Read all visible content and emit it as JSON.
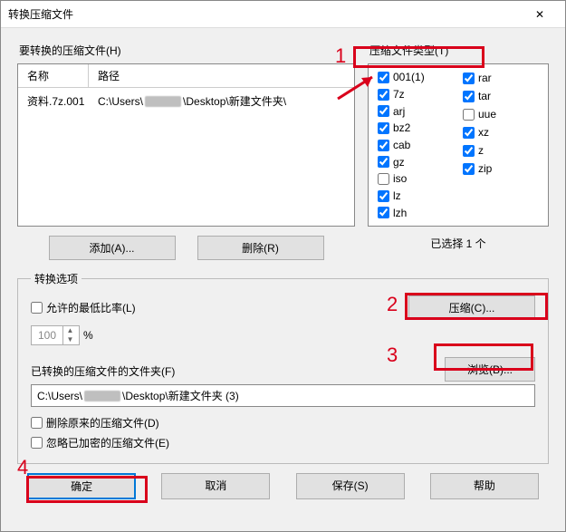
{
  "window": {
    "title": "转换压缩文件",
    "close": "✕"
  },
  "filesGroup": {
    "label": "要转换的压缩文件(H)",
    "colName": "名称",
    "colPath": "路径",
    "rows": [
      {
        "name": "资料.7z.001",
        "pathPrefix": "C:\\Users\\",
        "pathSuffix": "\\Desktop\\新建文件夹\\"
      }
    ],
    "addBtn": "添加(A)...",
    "removeBtn": "删除(R)"
  },
  "typesGroup": {
    "label": "压缩文件类型(T)",
    "left": [
      {
        "label": "001(1)",
        "checked": true
      },
      {
        "label": "7z",
        "checked": true
      },
      {
        "label": "arj",
        "checked": true
      },
      {
        "label": "bz2",
        "checked": true
      },
      {
        "label": "cab",
        "checked": true
      },
      {
        "label": "gz",
        "checked": true
      },
      {
        "label": "iso",
        "checked": false
      },
      {
        "label": "lz",
        "checked": true
      },
      {
        "label": "lzh",
        "checked": true
      }
    ],
    "right": [
      {
        "label": "rar",
        "checked": true
      },
      {
        "label": "tar",
        "checked": true
      },
      {
        "label": "uue",
        "checked": false
      },
      {
        "label": "xz",
        "checked": true
      },
      {
        "label": "z",
        "checked": true
      },
      {
        "label": "zip",
        "checked": true
      }
    ],
    "selectedText": "已选择 1 个"
  },
  "options": {
    "legend": "转换选项",
    "allowMin": "允许的最低比率(L)",
    "spinnerValue": "100",
    "percent": "%",
    "compressBtn": "压缩(C)...",
    "folderLabel": "已转换的压缩文件的文件夹(F)",
    "browseBtn": "浏览(B)...",
    "folderValuePrefix": "C:\\Users\\",
    "folderValueSuffix": "\\Desktop\\新建文件夹 (3)",
    "deleteOrig": "删除原来的压缩文件(D)",
    "ignoreEnc": "忽略已加密的压缩文件(E)"
  },
  "buttons": {
    "ok": "确定",
    "cancel": "取消",
    "save": "保存(S)",
    "help": "帮助"
  },
  "anno": {
    "n1": "1",
    "n2": "2",
    "n3": "3",
    "n4": "4"
  }
}
